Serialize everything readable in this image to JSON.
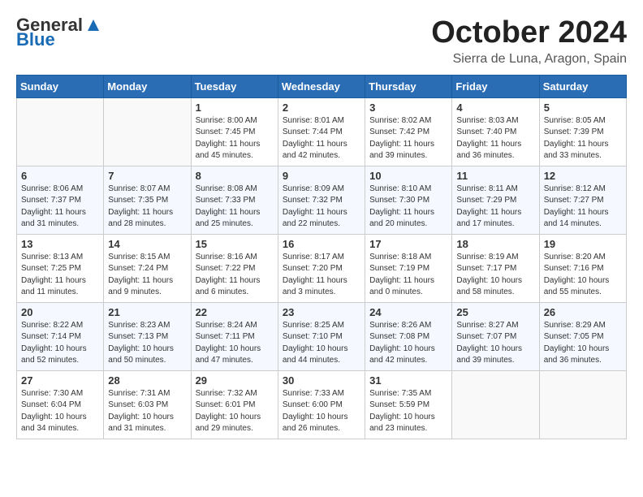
{
  "header": {
    "logo_general": "General",
    "logo_blue": "Blue",
    "month": "October 2024",
    "location": "Sierra de Luna, Aragon, Spain"
  },
  "days_of_week": [
    "Sunday",
    "Monday",
    "Tuesday",
    "Wednesday",
    "Thursday",
    "Friday",
    "Saturday"
  ],
  "weeks": [
    [
      {
        "day": "",
        "sunrise": "",
        "sunset": "",
        "daylight": ""
      },
      {
        "day": "",
        "sunrise": "",
        "sunset": "",
        "daylight": ""
      },
      {
        "day": "1",
        "sunrise": "Sunrise: 8:00 AM",
        "sunset": "Sunset: 7:45 PM",
        "daylight": "Daylight: 11 hours and 45 minutes."
      },
      {
        "day": "2",
        "sunrise": "Sunrise: 8:01 AM",
        "sunset": "Sunset: 7:44 PM",
        "daylight": "Daylight: 11 hours and 42 minutes."
      },
      {
        "day": "3",
        "sunrise": "Sunrise: 8:02 AM",
        "sunset": "Sunset: 7:42 PM",
        "daylight": "Daylight: 11 hours and 39 minutes."
      },
      {
        "day": "4",
        "sunrise": "Sunrise: 8:03 AM",
        "sunset": "Sunset: 7:40 PM",
        "daylight": "Daylight: 11 hours and 36 minutes."
      },
      {
        "day": "5",
        "sunrise": "Sunrise: 8:05 AM",
        "sunset": "Sunset: 7:39 PM",
        "daylight": "Daylight: 11 hours and 33 minutes."
      }
    ],
    [
      {
        "day": "6",
        "sunrise": "Sunrise: 8:06 AM",
        "sunset": "Sunset: 7:37 PM",
        "daylight": "Daylight: 11 hours and 31 minutes."
      },
      {
        "day": "7",
        "sunrise": "Sunrise: 8:07 AM",
        "sunset": "Sunset: 7:35 PM",
        "daylight": "Daylight: 11 hours and 28 minutes."
      },
      {
        "day": "8",
        "sunrise": "Sunrise: 8:08 AM",
        "sunset": "Sunset: 7:33 PM",
        "daylight": "Daylight: 11 hours and 25 minutes."
      },
      {
        "day": "9",
        "sunrise": "Sunrise: 8:09 AM",
        "sunset": "Sunset: 7:32 PM",
        "daylight": "Daylight: 11 hours and 22 minutes."
      },
      {
        "day": "10",
        "sunrise": "Sunrise: 8:10 AM",
        "sunset": "Sunset: 7:30 PM",
        "daylight": "Daylight: 11 hours and 20 minutes."
      },
      {
        "day": "11",
        "sunrise": "Sunrise: 8:11 AM",
        "sunset": "Sunset: 7:29 PM",
        "daylight": "Daylight: 11 hours and 17 minutes."
      },
      {
        "day": "12",
        "sunrise": "Sunrise: 8:12 AM",
        "sunset": "Sunset: 7:27 PM",
        "daylight": "Daylight: 11 hours and 14 minutes."
      }
    ],
    [
      {
        "day": "13",
        "sunrise": "Sunrise: 8:13 AM",
        "sunset": "Sunset: 7:25 PM",
        "daylight": "Daylight: 11 hours and 11 minutes."
      },
      {
        "day": "14",
        "sunrise": "Sunrise: 8:15 AM",
        "sunset": "Sunset: 7:24 PM",
        "daylight": "Daylight: 11 hours and 9 minutes."
      },
      {
        "day": "15",
        "sunrise": "Sunrise: 8:16 AM",
        "sunset": "Sunset: 7:22 PM",
        "daylight": "Daylight: 11 hours and 6 minutes."
      },
      {
        "day": "16",
        "sunrise": "Sunrise: 8:17 AM",
        "sunset": "Sunset: 7:20 PM",
        "daylight": "Daylight: 11 hours and 3 minutes."
      },
      {
        "day": "17",
        "sunrise": "Sunrise: 8:18 AM",
        "sunset": "Sunset: 7:19 PM",
        "daylight": "Daylight: 11 hours and 0 minutes."
      },
      {
        "day": "18",
        "sunrise": "Sunrise: 8:19 AM",
        "sunset": "Sunset: 7:17 PM",
        "daylight": "Daylight: 10 hours and 58 minutes."
      },
      {
        "day": "19",
        "sunrise": "Sunrise: 8:20 AM",
        "sunset": "Sunset: 7:16 PM",
        "daylight": "Daylight: 10 hours and 55 minutes."
      }
    ],
    [
      {
        "day": "20",
        "sunrise": "Sunrise: 8:22 AM",
        "sunset": "Sunset: 7:14 PM",
        "daylight": "Daylight: 10 hours and 52 minutes."
      },
      {
        "day": "21",
        "sunrise": "Sunrise: 8:23 AM",
        "sunset": "Sunset: 7:13 PM",
        "daylight": "Daylight: 10 hours and 50 minutes."
      },
      {
        "day": "22",
        "sunrise": "Sunrise: 8:24 AM",
        "sunset": "Sunset: 7:11 PM",
        "daylight": "Daylight: 10 hours and 47 minutes."
      },
      {
        "day": "23",
        "sunrise": "Sunrise: 8:25 AM",
        "sunset": "Sunset: 7:10 PM",
        "daylight": "Daylight: 10 hours and 44 minutes."
      },
      {
        "day": "24",
        "sunrise": "Sunrise: 8:26 AM",
        "sunset": "Sunset: 7:08 PM",
        "daylight": "Daylight: 10 hours and 42 minutes."
      },
      {
        "day": "25",
        "sunrise": "Sunrise: 8:27 AM",
        "sunset": "Sunset: 7:07 PM",
        "daylight": "Daylight: 10 hours and 39 minutes."
      },
      {
        "day": "26",
        "sunrise": "Sunrise: 8:29 AM",
        "sunset": "Sunset: 7:05 PM",
        "daylight": "Daylight: 10 hours and 36 minutes."
      }
    ],
    [
      {
        "day": "27",
        "sunrise": "Sunrise: 7:30 AM",
        "sunset": "Sunset: 6:04 PM",
        "daylight": "Daylight: 10 hours and 34 minutes."
      },
      {
        "day": "28",
        "sunrise": "Sunrise: 7:31 AM",
        "sunset": "Sunset: 6:03 PM",
        "daylight": "Daylight: 10 hours and 31 minutes."
      },
      {
        "day": "29",
        "sunrise": "Sunrise: 7:32 AM",
        "sunset": "Sunset: 6:01 PM",
        "daylight": "Daylight: 10 hours and 29 minutes."
      },
      {
        "day": "30",
        "sunrise": "Sunrise: 7:33 AM",
        "sunset": "Sunset: 6:00 PM",
        "daylight": "Daylight: 10 hours and 26 minutes."
      },
      {
        "day": "31",
        "sunrise": "Sunrise: 7:35 AM",
        "sunset": "Sunset: 5:59 PM",
        "daylight": "Daylight: 10 hours and 23 minutes."
      },
      {
        "day": "",
        "sunrise": "",
        "sunset": "",
        "daylight": ""
      },
      {
        "day": "",
        "sunrise": "",
        "sunset": "",
        "daylight": ""
      }
    ]
  ]
}
